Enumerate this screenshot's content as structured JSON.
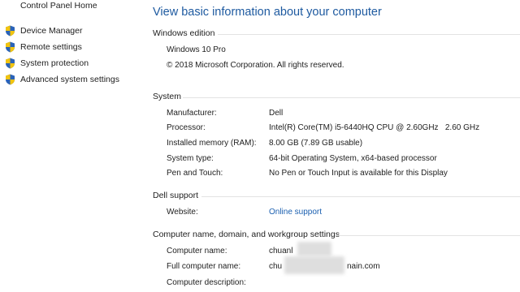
{
  "sidebar": {
    "home_link": "Control Panel Home",
    "items": [
      {
        "label": "Device Manager",
        "icon": "shield-icon"
      },
      {
        "label": "Remote settings",
        "icon": "shield-icon"
      },
      {
        "label": "System protection",
        "icon": "shield-icon"
      },
      {
        "label": "Advanced system settings",
        "icon": "shield-icon"
      }
    ]
  },
  "main": {
    "title": "View basic information about your computer",
    "windows_edition": {
      "header": "Windows edition",
      "edition": "Windows 10 Pro",
      "copyright": "© 2018 Microsoft Corporation. All rights reserved."
    },
    "system": {
      "header": "System",
      "rows": [
        {
          "label": "Manufacturer:",
          "value": "Dell"
        },
        {
          "label": "Processor:",
          "value": "Intel(R) Core(TM) i5-6440HQ CPU @ 2.60GHz   2.60 GHz"
        },
        {
          "label": "Installed memory (RAM):",
          "value": "8.00 GB (7.89 GB usable)"
        },
        {
          "label": "System type:",
          "value": "64-bit Operating System, x64-based processor"
        },
        {
          "label": "Pen and Touch:",
          "value": "No Pen or Touch Input is available for this Display"
        }
      ]
    },
    "dell_support": {
      "header": "Dell support",
      "website_label": "Website:",
      "website_link": "Online support"
    },
    "computer_name": {
      "header": "Computer name, domain, and workgroup settings",
      "rows": [
        {
          "label": "Computer name:",
          "value": "chuanl",
          "value_suffix": ""
        },
        {
          "label": "Full computer name:",
          "value": "chu",
          "value_suffix": "nain.com"
        },
        {
          "label": "Computer description:",
          "value": "",
          "value_suffix": ""
        }
      ]
    }
  },
  "colors": {
    "title_blue": "#1e5aa0",
    "link_blue": "#1a5fb0",
    "shield_blue": "#2a63b8",
    "shield_yellow": "#f2c40f"
  }
}
